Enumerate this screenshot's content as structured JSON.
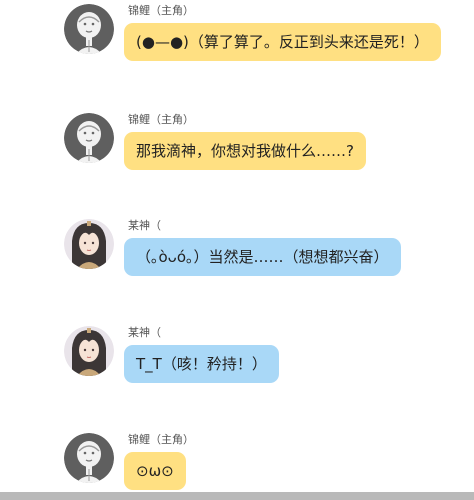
{
  "messages": [
    {
      "speaker": "锦鲤（主角）",
      "text": "(●—●)（算了算了。反正到头来还是死！）",
      "bubble_color": "#ffe082",
      "avatar": "gray-sketch-avatar"
    },
    {
      "speaker": "锦鲤（主角）",
      "text": "那我滴神，你想对我做什么……?",
      "bubble_color": "#ffe082",
      "avatar": "gray-sketch-avatar"
    },
    {
      "speaker": "某神（",
      "text": "（｡òᴗó｡）当然是……（想想都兴奋）",
      "bubble_color": "#a9d8f7",
      "avatar": "anime-character-avatar"
    },
    {
      "speaker": "某神（",
      "text": "T_T（咳！矜持！）",
      "bubble_color": "#a9d8f7",
      "avatar": "anime-character-avatar"
    },
    {
      "speaker": "锦鲤（主角）",
      "text": "⊙ω⊙",
      "bubble_color": "#ffe082",
      "avatar": "gray-sketch-avatar"
    }
  ]
}
